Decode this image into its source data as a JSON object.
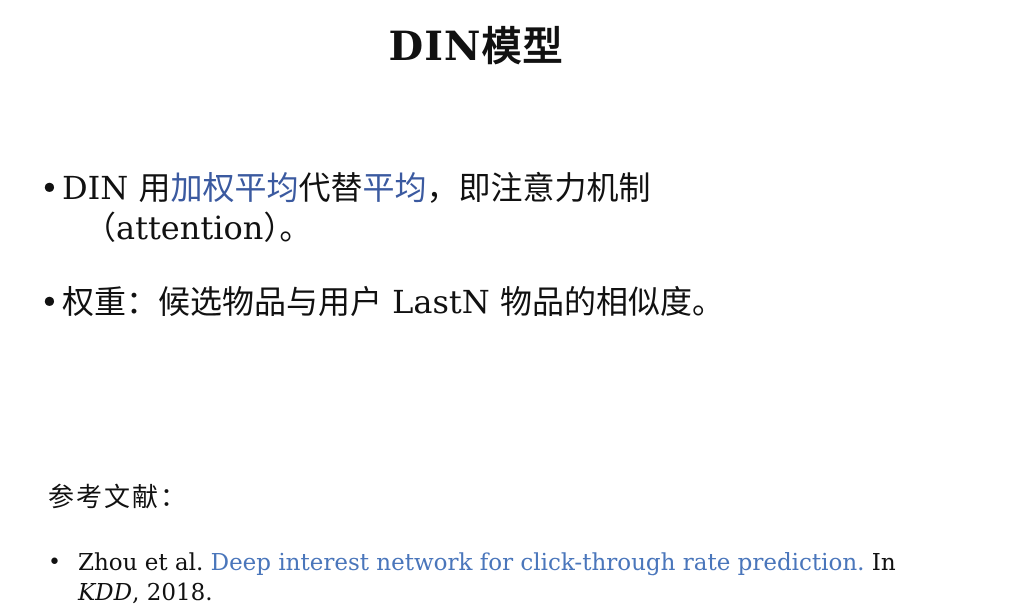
{
  "slide": {
    "title": "DIN模型"
  },
  "bullets": [
    {
      "dot": "•",
      "parts": [
        "DIN 用",
        "加权平均",
        "代替",
        "平均",
        "，即注意力机制"
      ],
      "continuation": "（attention）。"
    },
    {
      "dot": "•",
      "text": "权重：候选物品与用户 LastN 物品的相似度。"
    }
  ],
  "references": {
    "heading": "参考文献：",
    "items": [
      {
        "dot": "•",
        "authors": "Zhou et al. ",
        "title": "Deep interest network for click-through rate prediction.",
        "in": " In",
        "venue": "KDD",
        "year": ", 2018."
      }
    ]
  },
  "colors": {
    "highlight": "#3b5aa0",
    "link": "#4a76bb",
    "text": "#111111"
  }
}
